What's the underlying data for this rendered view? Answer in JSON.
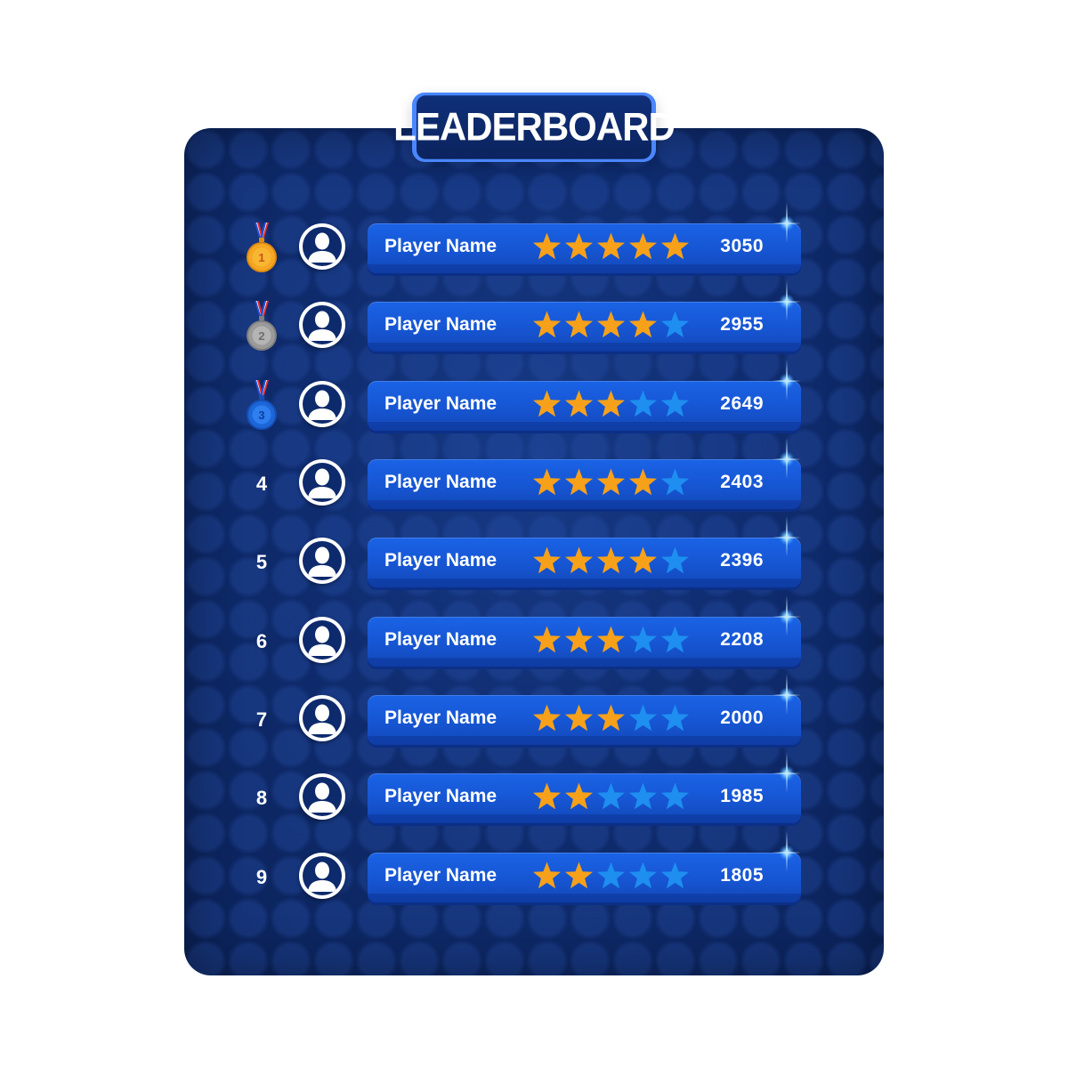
{
  "title": "LEADERBOARD",
  "colors": {
    "panel": "#0e2a6c",
    "bar": "#1a63e6",
    "star_filled": "#f7a11a",
    "star_empty": "#1e8ef0",
    "title_border": "#4a86ff"
  },
  "players": [
    {
      "rank": "1",
      "medal": "gold",
      "name": "Player Name",
      "stars": 5,
      "score": "3050"
    },
    {
      "rank": "2",
      "medal": "silver",
      "name": "Player Name",
      "stars": 4,
      "score": "2955"
    },
    {
      "rank": "3",
      "medal": "bronze-blue",
      "name": "Player Name",
      "stars": 3,
      "score": "2649"
    },
    {
      "rank": "4",
      "medal": null,
      "name": "Player Name",
      "stars": 4,
      "score": "2403"
    },
    {
      "rank": "5",
      "medal": null,
      "name": "Player Name",
      "stars": 4,
      "score": "2396"
    },
    {
      "rank": "6",
      "medal": null,
      "name": "Player Name",
      "stars": 3,
      "score": "2208"
    },
    {
      "rank": "7",
      "medal": null,
      "name": "Player Name",
      "stars": 3,
      "score": "2000"
    },
    {
      "rank": "8",
      "medal": null,
      "name": "Player Name",
      "stars": 2,
      "score": "1985"
    },
    {
      "rank": "9",
      "medal": null,
      "name": "Player Name",
      "stars": 2,
      "score": "1805"
    }
  ],
  "max_stars": 5,
  "icons": {
    "avatar": "user-silhouette-icon",
    "star": "star-icon",
    "medal": "medal-icon"
  }
}
